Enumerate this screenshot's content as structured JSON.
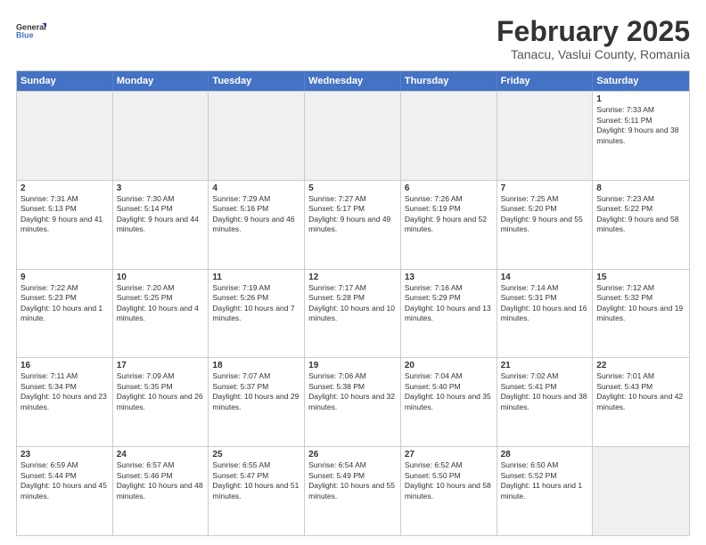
{
  "logo": {
    "line1": "General",
    "line2": "Blue"
  },
  "title": "February 2025",
  "subtitle": "Tanacu, Vaslui County, Romania",
  "days_of_week": [
    "Sunday",
    "Monday",
    "Tuesday",
    "Wednesday",
    "Thursday",
    "Friday",
    "Saturday"
  ],
  "weeks": [
    [
      {
        "day": "",
        "info": ""
      },
      {
        "day": "",
        "info": ""
      },
      {
        "day": "",
        "info": ""
      },
      {
        "day": "",
        "info": ""
      },
      {
        "day": "",
        "info": ""
      },
      {
        "day": "",
        "info": ""
      },
      {
        "day": "1",
        "info": "Sunrise: 7:33 AM\nSunset: 5:11 PM\nDaylight: 9 hours and 38 minutes."
      }
    ],
    [
      {
        "day": "2",
        "info": "Sunrise: 7:31 AM\nSunset: 5:13 PM\nDaylight: 9 hours and 41 minutes."
      },
      {
        "day": "3",
        "info": "Sunrise: 7:30 AM\nSunset: 5:14 PM\nDaylight: 9 hours and 44 minutes."
      },
      {
        "day": "4",
        "info": "Sunrise: 7:29 AM\nSunset: 5:16 PM\nDaylight: 9 hours and 46 minutes."
      },
      {
        "day": "5",
        "info": "Sunrise: 7:27 AM\nSunset: 5:17 PM\nDaylight: 9 hours and 49 minutes."
      },
      {
        "day": "6",
        "info": "Sunrise: 7:26 AM\nSunset: 5:19 PM\nDaylight: 9 hours and 52 minutes."
      },
      {
        "day": "7",
        "info": "Sunrise: 7:25 AM\nSunset: 5:20 PM\nDaylight: 9 hours and 55 minutes."
      },
      {
        "day": "8",
        "info": "Sunrise: 7:23 AM\nSunset: 5:22 PM\nDaylight: 9 hours and 58 minutes."
      }
    ],
    [
      {
        "day": "9",
        "info": "Sunrise: 7:22 AM\nSunset: 5:23 PM\nDaylight: 10 hours and 1 minute."
      },
      {
        "day": "10",
        "info": "Sunrise: 7:20 AM\nSunset: 5:25 PM\nDaylight: 10 hours and 4 minutes."
      },
      {
        "day": "11",
        "info": "Sunrise: 7:19 AM\nSunset: 5:26 PM\nDaylight: 10 hours and 7 minutes."
      },
      {
        "day": "12",
        "info": "Sunrise: 7:17 AM\nSunset: 5:28 PM\nDaylight: 10 hours and 10 minutes."
      },
      {
        "day": "13",
        "info": "Sunrise: 7:16 AM\nSunset: 5:29 PM\nDaylight: 10 hours and 13 minutes."
      },
      {
        "day": "14",
        "info": "Sunrise: 7:14 AM\nSunset: 5:31 PM\nDaylight: 10 hours and 16 minutes."
      },
      {
        "day": "15",
        "info": "Sunrise: 7:12 AM\nSunset: 5:32 PM\nDaylight: 10 hours and 19 minutes."
      }
    ],
    [
      {
        "day": "16",
        "info": "Sunrise: 7:11 AM\nSunset: 5:34 PM\nDaylight: 10 hours and 23 minutes."
      },
      {
        "day": "17",
        "info": "Sunrise: 7:09 AM\nSunset: 5:35 PM\nDaylight: 10 hours and 26 minutes."
      },
      {
        "day": "18",
        "info": "Sunrise: 7:07 AM\nSunset: 5:37 PM\nDaylight: 10 hours and 29 minutes."
      },
      {
        "day": "19",
        "info": "Sunrise: 7:06 AM\nSunset: 5:38 PM\nDaylight: 10 hours and 32 minutes."
      },
      {
        "day": "20",
        "info": "Sunrise: 7:04 AM\nSunset: 5:40 PM\nDaylight: 10 hours and 35 minutes."
      },
      {
        "day": "21",
        "info": "Sunrise: 7:02 AM\nSunset: 5:41 PM\nDaylight: 10 hours and 38 minutes."
      },
      {
        "day": "22",
        "info": "Sunrise: 7:01 AM\nSunset: 5:43 PM\nDaylight: 10 hours and 42 minutes."
      }
    ],
    [
      {
        "day": "23",
        "info": "Sunrise: 6:59 AM\nSunset: 5:44 PM\nDaylight: 10 hours and 45 minutes."
      },
      {
        "day": "24",
        "info": "Sunrise: 6:57 AM\nSunset: 5:46 PM\nDaylight: 10 hours and 48 minutes."
      },
      {
        "day": "25",
        "info": "Sunrise: 6:55 AM\nSunset: 5:47 PM\nDaylight: 10 hours and 51 minutes."
      },
      {
        "day": "26",
        "info": "Sunrise: 6:54 AM\nSunset: 5:49 PM\nDaylight: 10 hours and 55 minutes."
      },
      {
        "day": "27",
        "info": "Sunrise: 6:52 AM\nSunset: 5:50 PM\nDaylight: 10 hours and 58 minutes."
      },
      {
        "day": "28",
        "info": "Sunrise: 6:50 AM\nSunset: 5:52 PM\nDaylight: 11 hours and 1 minute."
      },
      {
        "day": "",
        "info": ""
      }
    ]
  ]
}
